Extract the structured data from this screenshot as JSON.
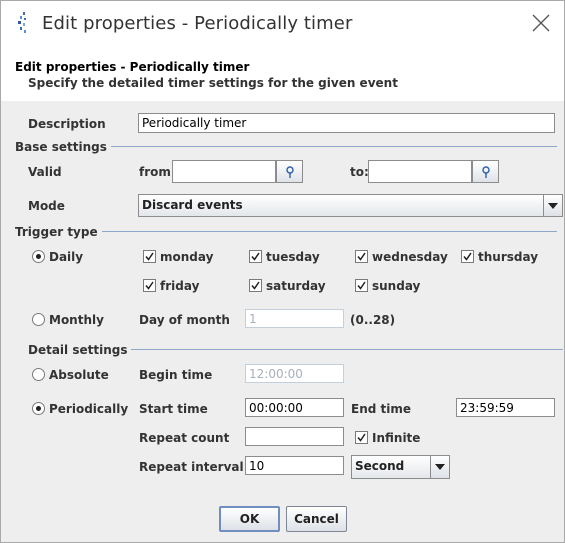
{
  "window": {
    "title": "Edit properties - Periodically timer"
  },
  "header": {
    "title": "Edit properties - Periodically timer",
    "subtitle": "Specify the detailed timer settings for the given event"
  },
  "description": {
    "label": "Description",
    "value": "Periodically timer"
  },
  "base_settings": {
    "section_label": "Base settings",
    "valid_label": "Valid",
    "from_label": "from:",
    "from_value": "",
    "to_label": "to:",
    "to_value": "",
    "mode_label": "Mode",
    "mode_value": "Discard events"
  },
  "trigger_type": {
    "section_label": "Trigger type",
    "daily": {
      "label": "Daily",
      "selected": true
    },
    "days": [
      {
        "label": "monday",
        "checked": true
      },
      {
        "label": "tuesday",
        "checked": true
      },
      {
        "label": "wednesday",
        "checked": true
      },
      {
        "label": "thursday",
        "checked": true
      },
      {
        "label": "friday",
        "checked": true
      },
      {
        "label": "saturday",
        "checked": true
      },
      {
        "label": "sunday",
        "checked": true
      }
    ],
    "monthly": {
      "label": "Monthly",
      "selected": false
    },
    "day_of_month_label": "Day of month",
    "day_of_month_value": "1",
    "day_of_month_hint": "(0..28)"
  },
  "detail_settings": {
    "section_label": "Detail settings",
    "absolute": {
      "label": "Absolute",
      "selected": false
    },
    "begin_time_label": "Begin time",
    "begin_time_value": "12:00:00",
    "periodically": {
      "label": "Periodically",
      "selected": true
    },
    "start_time_label": "Start time",
    "start_time_value": "00:00:00",
    "end_time_label": "End time",
    "end_time_value": "23:59:59",
    "repeat_count_label": "Repeat count",
    "repeat_count_value": "",
    "infinite_label": "Infinite",
    "infinite_checked": true,
    "repeat_interval_label": "Repeat interval",
    "repeat_interval_value": "10",
    "interval_unit": "Second"
  },
  "buttons": {
    "ok": "OK",
    "cancel": "Cancel"
  },
  "icons": {
    "app": "app-logo-icon",
    "close": "close-icon",
    "date_picker": "date-picker-icon",
    "dropdown": "chevron-down-icon",
    "check": "check-icon"
  },
  "colors": {
    "title_bar": "#ffffff",
    "dialog_background": "#eeeeee",
    "separator": "#8ea7cb",
    "default_button_border": "#6f8fc0"
  }
}
